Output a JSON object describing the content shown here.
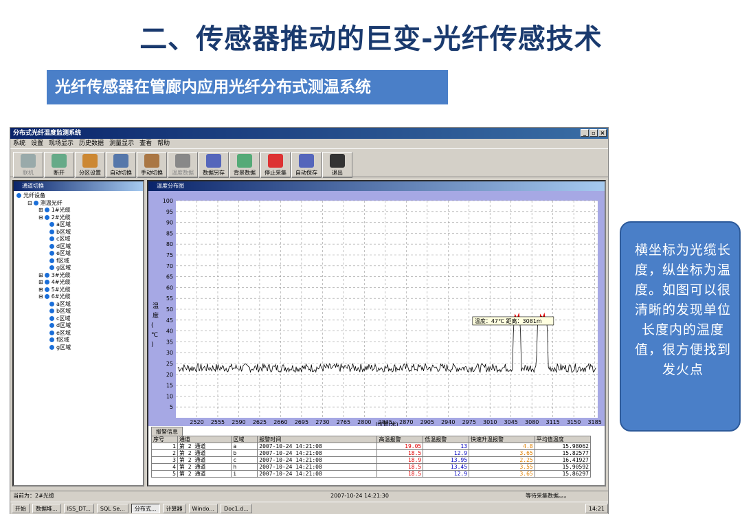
{
  "slide": {
    "title": "二、传感器推动的巨变-光纤传感技术",
    "subtitle": "光纤传感器在管廊内应用光纤分布式测温系统",
    "callout": "横坐标为光缆长度，纵坐标为温度。如图可以很清晰的发现单位长度内的温度值，很方便找到发火点"
  },
  "window": {
    "title": "分布式光纤温度监测系统",
    "controls": [
      "_",
      "▫",
      "×"
    ]
  },
  "menu": [
    "系统",
    "设置",
    "现场显示",
    "历史数据",
    "测量显示",
    "查看",
    "帮助"
  ],
  "toolbar": [
    {
      "label": "联机",
      "disabled": true,
      "color": "#9aa"
    },
    {
      "label": "断开",
      "disabled": false,
      "color": "#6a8"
    },
    {
      "label": "分区设置",
      "disabled": false,
      "color": "#c83"
    },
    {
      "label": "自动切换",
      "disabled": false,
      "color": "#57a"
    },
    {
      "label": "手动切换",
      "disabled": false,
      "color": "#a74"
    },
    {
      "label": "温度数据",
      "disabled": true,
      "color": "#888"
    },
    {
      "label": "数据另存",
      "disabled": false,
      "color": "#56b"
    },
    {
      "label": "背景数据",
      "disabled": false,
      "color": "#5a7"
    },
    {
      "label": "停止采集",
      "disabled": false,
      "color": "#d33"
    },
    {
      "label": "自动保存",
      "disabled": false,
      "color": "#56b"
    },
    {
      "label": "退出",
      "disabled": false,
      "color": "#333"
    }
  ],
  "left_panel": {
    "title": "通道切换",
    "tree": [
      {
        "label": "光纤设备",
        "indent": 0,
        "sign": ""
      },
      {
        "label": "测温光纤",
        "indent": 1,
        "sign": "⊟"
      },
      {
        "label": "1#光缆",
        "indent": 2,
        "sign": "⊞"
      },
      {
        "label": "2#光缆",
        "indent": 2,
        "sign": "⊟"
      },
      {
        "label": "a区域",
        "indent": 3,
        "sign": ""
      },
      {
        "label": "b区域",
        "indent": 3,
        "sign": ""
      },
      {
        "label": "c区域",
        "indent": 3,
        "sign": ""
      },
      {
        "label": "d区域",
        "indent": 3,
        "sign": ""
      },
      {
        "label": "e区域",
        "indent": 3,
        "sign": ""
      },
      {
        "label": "f区域",
        "indent": 3,
        "sign": ""
      },
      {
        "label": "g区域",
        "indent": 3,
        "sign": ""
      },
      {
        "label": "3#光缆",
        "indent": 2,
        "sign": "⊞"
      },
      {
        "label": "4#光缆",
        "indent": 2,
        "sign": "⊞"
      },
      {
        "label": "5#光缆",
        "indent": 2,
        "sign": "⊞"
      },
      {
        "label": "6#光缆",
        "indent": 2,
        "sign": "⊟"
      },
      {
        "label": "a区域",
        "indent": 3,
        "sign": ""
      },
      {
        "label": "b区域",
        "indent": 3,
        "sign": ""
      },
      {
        "label": "c区域",
        "indent": 3,
        "sign": ""
      },
      {
        "label": "d区域",
        "indent": 3,
        "sign": ""
      },
      {
        "label": "e区域",
        "indent": 3,
        "sign": ""
      },
      {
        "label": "f区域",
        "indent": 3,
        "sign": ""
      },
      {
        "label": "g区域",
        "indent": 3,
        "sign": ""
      }
    ]
  },
  "chart_panel": {
    "title": "温度分布图"
  },
  "chart_data": {
    "type": "line",
    "ylabel": "温度(℃)",
    "xlabel": "(位置(米)",
    "ylim": [
      0,
      100
    ],
    "xlim": [
      2485,
      3190
    ],
    "yticks": [
      5,
      10,
      15,
      20,
      25,
      30,
      35,
      40,
      45,
      50,
      55,
      60,
      65,
      70,
      75,
      80,
      85,
      90,
      95,
      100
    ],
    "yticklabels": [
      "5",
      "10",
      "15",
      "20",
      "25",
      "30",
      "35",
      "40",
      "45",
      "50",
      "55",
      "60",
      "65",
      "70",
      "75",
      "80",
      "85",
      "90",
      "95",
      "100"
    ],
    "xticks": [
      2520,
      2555,
      2590,
      2625,
      2660,
      2695,
      2730,
      2765,
      2800,
      2835,
      2870,
      2905,
      2940,
      2975,
      3010,
      3045,
      3080,
      3115,
      3150,
      3185
    ],
    "xticklabels": [
      "2520",
      "2555",
      "2590",
      "2625",
      "2660",
      "2695",
      "2730",
      "2765",
      "2800",
      "2835",
      "2870",
      "2905",
      "2940",
      "2975",
      "3010",
      "3045",
      "3080",
      "3115",
      "3150",
      "3185"
    ],
    "grid": true,
    "tooltip": "温度：47℃ 距离：3081m",
    "baseline": 23,
    "hotspots": [
      {
        "x_start": 3048,
        "x_end": 3062,
        "peak": 47
      },
      {
        "x_start": 3088,
        "x_end": 3107,
        "peak": 47
      }
    ],
    "line_color": "#000000",
    "peak_color": "#e00000"
  },
  "alarm": {
    "tab": "报警信息",
    "headers": [
      "序号",
      "通道",
      "区域",
      "报警时间",
      "高温报警",
      "低温报警",
      "快速升温报警",
      "平均值温度"
    ],
    "rows": [
      [
        "1",
        "第 2 通道",
        "a",
        "2007-10-24 14:21:08",
        "19.05",
        "13",
        "4.8",
        "15.98062"
      ],
      [
        "2",
        "第 2 通道",
        "b",
        "2007-10-24 14:21:08",
        "18.5",
        "12.9",
        "3.65",
        "15.82577"
      ],
      [
        "3",
        "第 2 通道",
        "c",
        "2007-10-24 14:21:08",
        "18.9",
        "13.95",
        "2.25",
        "16.41927"
      ],
      [
        "4",
        "第 2 通道",
        "h",
        "2007-10-24 14:21:08",
        "18.5",
        "13.45",
        "3.55",
        "15.90592"
      ],
      [
        "5",
        "第 2 通道",
        "i",
        "2007-10-24 14:21:08",
        "18.5",
        "12.9",
        "3.65",
        "15.86297"
      ]
    ]
  },
  "status": {
    "left": "当前为：2#光缆",
    "time": "2007-10-24 14:21:30",
    "right": "等待采集数据。。。"
  },
  "taskbar": {
    "start": "开始",
    "tasks": [
      "数据堆...",
      "ISS_DT...",
      "SQL Se...",
      "分布式...",
      "计算器",
      "Windo...",
      "Doc1.d..."
    ],
    "clock": "14:21"
  }
}
